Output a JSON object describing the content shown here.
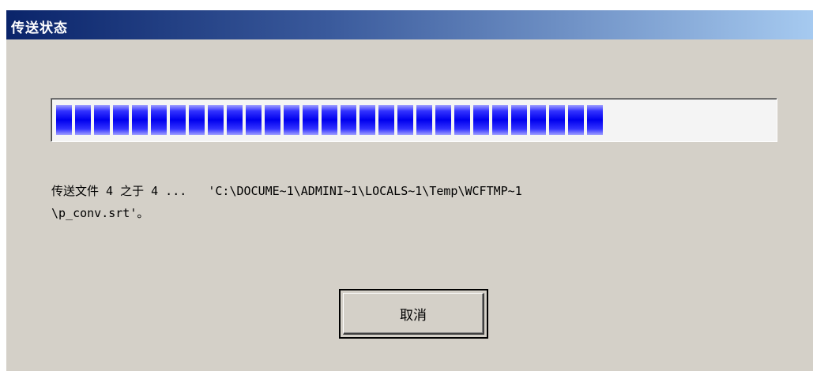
{
  "window": {
    "title": "传送状态"
  },
  "progress": {
    "fraction": 0.757,
    "color": "#0000ee"
  },
  "status": {
    "line1": "传送文件 4 之于 4 ...   'C:\\DOCUME~1\\ADMINI~1\\LOCALS~1\\Temp\\WCFTMP~1",
    "line2": "\\p_conv.srt'。"
  },
  "buttons": {
    "cancel_label": "取消"
  }
}
